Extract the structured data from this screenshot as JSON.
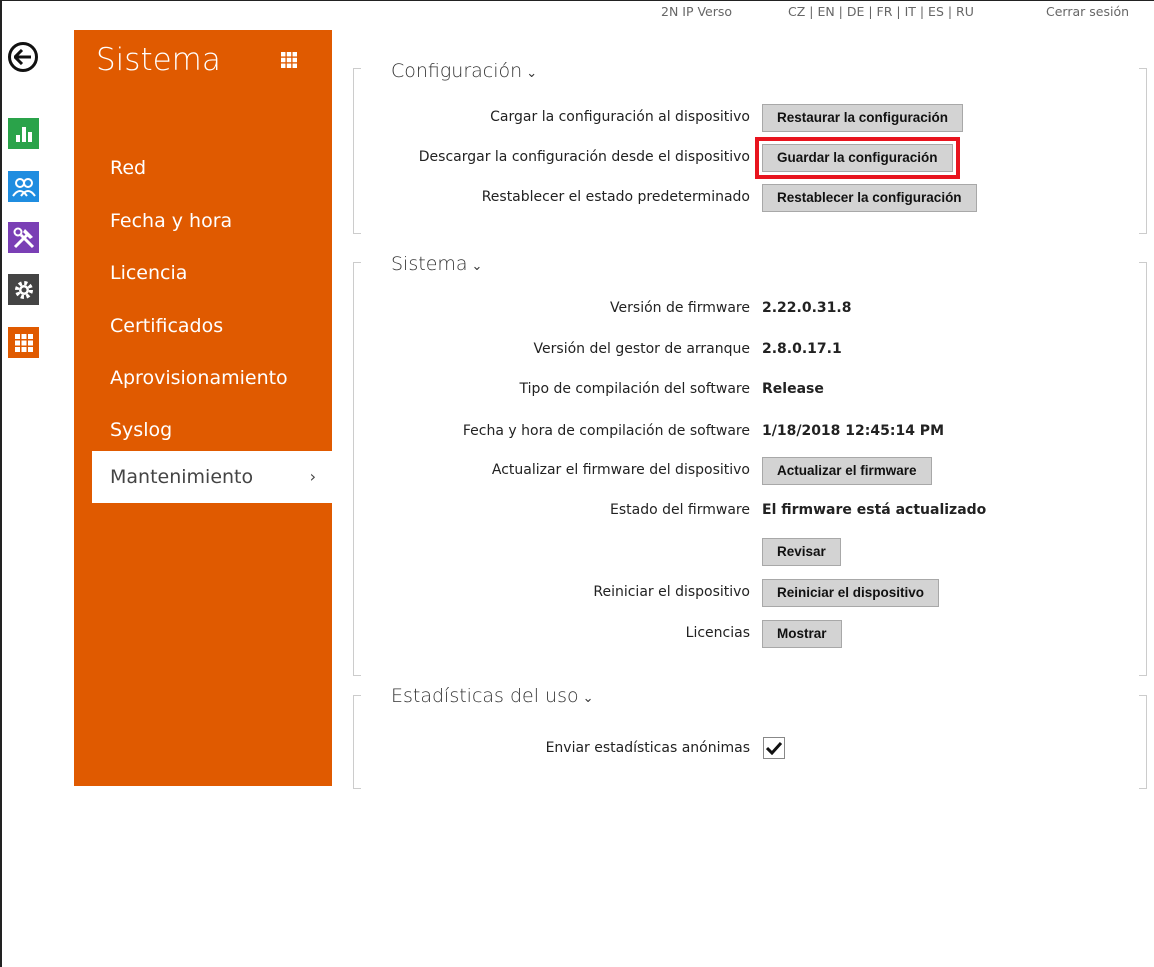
{
  "topbar": {
    "device_name": "2N IP Verso",
    "languages": "CZ | EN | DE | FR | IT | ES | RU",
    "logout": "Cerrar sesión"
  },
  "rail": {
    "icons": [
      "back-arrow-icon",
      "status-chart-icon",
      "directory-users-icon",
      "hardware-tools-icon",
      "services-gear-icon",
      "system-grid-icon"
    ]
  },
  "sidebar": {
    "title": "Sistema",
    "items": [
      {
        "label": "Red"
      },
      {
        "label": "Fecha y hora"
      },
      {
        "label": "Licencia"
      },
      {
        "label": "Certificados"
      },
      {
        "label": "Aprovisionamiento"
      },
      {
        "label": "Syslog"
      },
      {
        "label": "Mantenimiento",
        "chevron": "›"
      }
    ]
  },
  "configuracion": {
    "title": "Configuración",
    "caret": "⌄",
    "rows": [
      {
        "label": "Cargar la configuración al dispositivo",
        "button": "Restaurar la configuración"
      },
      {
        "label": "Descargar la configuración desde el dispositivo",
        "button": "Guardar la configuración"
      },
      {
        "label": "Restablecer el estado predeterminado",
        "button": "Restablecer la configuración"
      }
    ]
  },
  "sistema": {
    "title": "Sistema",
    "caret": "⌄",
    "firmware_version": {
      "label": "Versión de firmware",
      "value": "2.22.0.31.8"
    },
    "bootloader_version": {
      "label": "Versión del gestor de arranque",
      "value": "2.8.0.17.1"
    },
    "build_type": {
      "label": "Tipo de compilación del software",
      "value": "Release"
    },
    "build_date": {
      "label": "Fecha y hora de compilación de software",
      "value": "1/18/2018 12:45:14 PM"
    },
    "update_firmware": {
      "label": "Actualizar el firmware del dispositivo",
      "button": "Actualizar el firmware"
    },
    "firmware_status": {
      "label": "Estado del firmware",
      "value": "El firmware está actualizado"
    },
    "check": {
      "button": "Revisar"
    },
    "restart": {
      "label": "Reiniciar el dispositivo",
      "button": "Reiniciar el dispositivo"
    },
    "licenses": {
      "label": "Licencias",
      "button": "Mostrar"
    }
  },
  "estadisticas": {
    "title": "Estadísticas del uso",
    "caret": "⌄",
    "anonymous_stats": {
      "label": "Enviar estadísticas anónimas",
      "checked": true
    }
  },
  "colors": {
    "accent_orange": "#e05a00",
    "highlight_red": "#e8141e",
    "button_gray": "#d3d3d3"
  }
}
